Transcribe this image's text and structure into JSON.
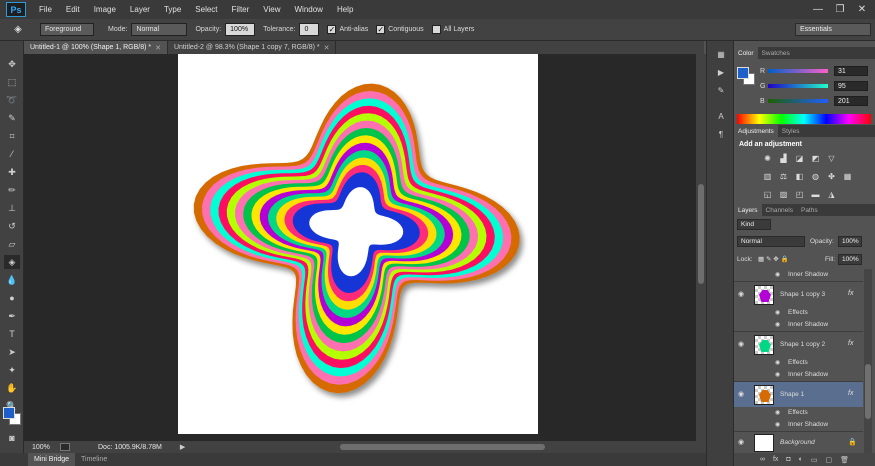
{
  "app": {
    "logo": "Ps"
  },
  "menu": [
    "File",
    "Edit",
    "Image",
    "Layer",
    "Type",
    "Select",
    "Filter",
    "View",
    "Window",
    "Help"
  ],
  "window_controls": {
    "minimize": "—",
    "restore": "❐",
    "close": "✕"
  },
  "options_bar": {
    "fill_source": "Foreground",
    "mode_label": "Mode:",
    "mode_value": "Normal",
    "opacity_label": "Opacity:",
    "opacity_value": "100%",
    "tolerance_label": "Tolerance:",
    "tolerance_value": "0",
    "anti_alias_label": "Anti-alias",
    "contiguous_label": "Contiguous",
    "all_layers_label": "All Layers",
    "workspace": "Essentials"
  },
  "doc_tabs": [
    {
      "label": "Untitled-1 @ 100% (Shape 1, RGB/8) *",
      "active": true
    },
    {
      "label": "Untitled-2 @ 98.3% (Shape 1 copy 7, RGB/8) *",
      "active": false
    }
  ],
  "status": {
    "zoom": "100%",
    "doc_size": "Doc: 1005.9K/8.78M"
  },
  "bottom_tabs": [
    "Mini Bridge",
    "Timeline"
  ],
  "color_panel": {
    "tabs": [
      "Color",
      "Swatches"
    ],
    "fg_color": "#1f5fc9",
    "r": {
      "label": "R",
      "value": "31"
    },
    "g": {
      "label": "G",
      "value": "95"
    },
    "b": {
      "label": "B",
      "value": "201"
    }
  },
  "adjustments_panel": {
    "tabs": [
      "Adjustments",
      "Styles"
    ],
    "title": "Add an adjustment"
  },
  "layers_panel": {
    "tabs": [
      "Layers",
      "Channels",
      "Paths"
    ],
    "filter_kind": "Kind",
    "blend_mode": "Normal",
    "opacity_label": "Opacity:",
    "opacity_value": "100%",
    "lock_label": "Lock:",
    "fill_label": "Fill:",
    "fill_value": "100%",
    "inner_shadow_top": "Inner Shadow",
    "layers": [
      {
        "name": "Shape 1 copy 3",
        "effects": "Effects",
        "effect": "Inner Shadow",
        "fx": "fx",
        "thumb_color": "#b400d6",
        "selected": false
      },
      {
        "name": "Shape 1 copy 2",
        "effects": "Effects",
        "effect": "Inner Shadow",
        "fx": "fx",
        "thumb_color": "#00d884",
        "selected": false
      },
      {
        "name": "Shape 1",
        "effects": "Effects",
        "effect": "Inner Shadow",
        "fx": "fx",
        "thumb_color": "#d46b05",
        "selected": true
      }
    ],
    "background_layer": "Background"
  },
  "artwork": {
    "rings": [
      "#d46b05",
      "#ff6fb0",
      "#00ffd2",
      "#ff1060",
      "#b4ff00",
      "#ff6fb0",
      "#00c44a",
      "#ffe600",
      "#b400d6",
      "#00d884",
      "#ffdd00",
      "#ff2a7a",
      "#1234d6"
    ]
  }
}
